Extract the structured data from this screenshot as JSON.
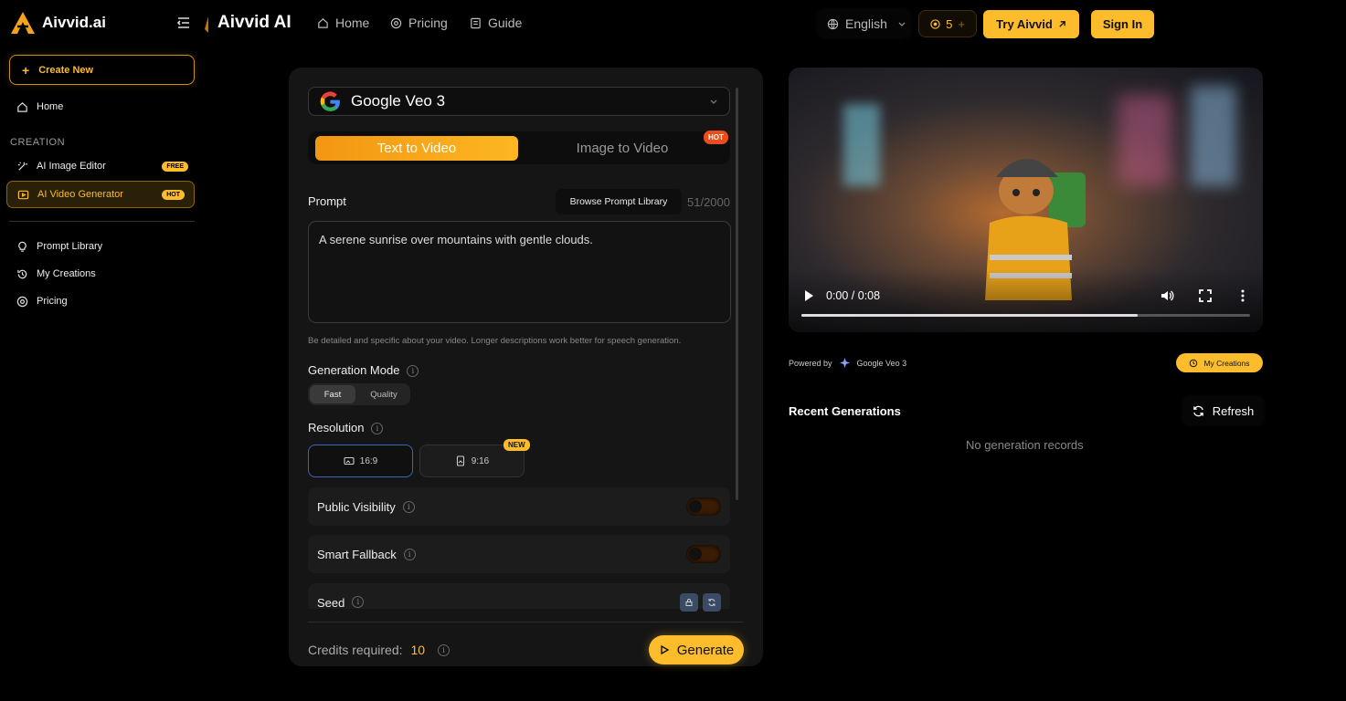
{
  "sidebar": {
    "logo_text": "Aivvid.ai",
    "create_new": "Create New",
    "home": "Home",
    "section_creation": "CREATION",
    "ai_image_editor": "AI Image Editor",
    "free_badge": "FREE",
    "ai_video_generator": "AI Video Generator",
    "hot_badge": "HOT",
    "prompt_library": "Prompt Library",
    "my_creations": "My Creations",
    "pricing": "Pricing"
  },
  "header": {
    "brand": "Aivvid AI",
    "nav": [
      {
        "label": "Home",
        "icon": "home-icon"
      },
      {
        "label": "Pricing",
        "icon": "pricing-icon"
      },
      {
        "label": "Guide",
        "icon": "guide-icon"
      }
    ],
    "language": "English",
    "credits": "5",
    "try_label": "Try Aivvid",
    "signin_label": "Sign In"
  },
  "form": {
    "model": "Google Veo 3",
    "tabs": {
      "text_to_video": "Text to Video",
      "image_to_video": "Image to Video",
      "hot": "HOT"
    },
    "prompt_label": "Prompt",
    "browse_library": "Browse Prompt Library",
    "char_count": "51/2000",
    "prompt_value": "A serene sunrise over mountains with gentle clouds.",
    "prompt_hint": "Be detailed and specific about your video. Longer descriptions work better for speech generation.",
    "generation_mode_label": "Generation Mode",
    "mode_fast": "Fast",
    "mode_quality": "Quality",
    "resolution_label": "Resolution",
    "res_16_9": "16:9",
    "res_9_16": "9:16",
    "new_badge": "NEW",
    "public_visibility": "Public Visibility",
    "smart_fallback": "Smart Fallback",
    "seed": "Seed",
    "credits_required_label": "Credits required:",
    "credits_required_value": "10",
    "generate": "Generate"
  },
  "video": {
    "time": "0:00 / 0:08",
    "progress": 0.75
  },
  "right": {
    "powered_by": "Powered by",
    "powered_model": "Google Veo 3",
    "my_creations": "My Creations",
    "recent_title": "Recent Generations",
    "refresh": "Refresh",
    "no_records": "No generation records"
  },
  "colors": {
    "accent": "#fcbc2c",
    "hot": "#e84d1c",
    "selected_border": "#3767b5"
  }
}
